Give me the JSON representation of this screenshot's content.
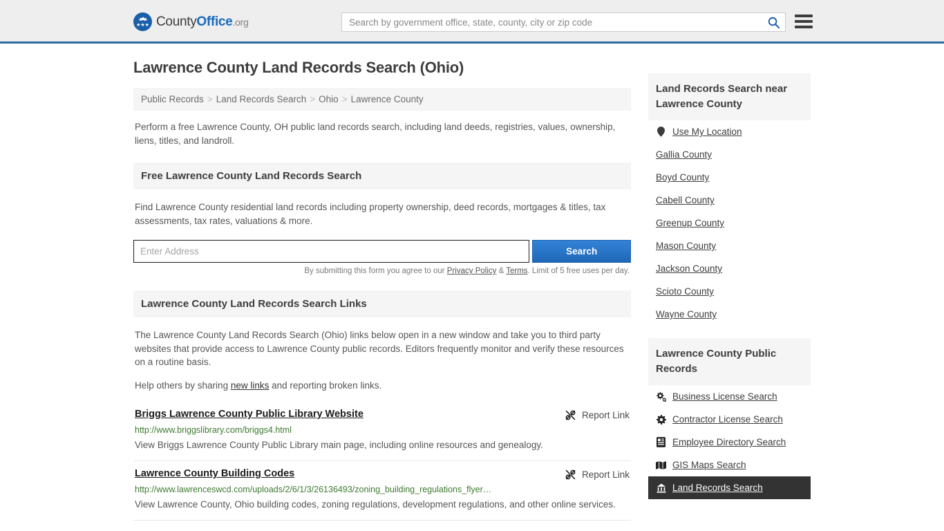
{
  "header": {
    "logo": {
      "part1": "County",
      "part2": "Office",
      "part3": ".org",
      "icon": "eagle-seal-icon"
    },
    "search_placeholder": "Search by government office, state, county, city or zip code",
    "search_value": "",
    "search_icon": "search-icon",
    "menu_icon": "hamburger-menu-icon"
  },
  "page": {
    "title": "Lawrence County Land Records Search (Ohio)",
    "intro": "Perform a free Lawrence County, OH public land records search, including land deeds, registries, values, ownership, liens, titles, and landroll."
  },
  "breadcrumb": {
    "items": [
      "Public Records",
      "Land Records Search",
      "Ohio",
      "Lawrence County"
    ],
    "separator": ">"
  },
  "free_search": {
    "heading": "Free Lawrence County Land Records Search",
    "description": "Find Lawrence County residential land records including property ownership, deed records, mortgages & titles, tax assessments, tax rates, valuations & more.",
    "input_placeholder": "Enter Address",
    "input_value": "",
    "submit_label": "Search",
    "note_prefix": "By submitting this form you agree to our ",
    "note_privacy": "Privacy Policy",
    "note_amp": " & ",
    "note_terms": "Terms",
    "note_suffix": ". Limit of 5 free uses per day."
  },
  "links_section": {
    "heading": "Lawrence County Land Records Search Links",
    "paragraph": "The Lawrence County Land Records Search (Ohio) links below open in a new window and take you to third party websites that provide access to Lawrence County public records. Editors frequently monitor and verify these resources on a routine basis.",
    "help_prefix": "Help others by sharing ",
    "help_link": "new links",
    "help_suffix": " and reporting broken links.",
    "report_label": "Report Link",
    "report_icon": "broken-link-icon",
    "results": [
      {
        "title": "Briggs Lawrence County Public Library Website",
        "url": "http://www.briggslibrary.com/briggs4.html",
        "description": "View Briggs Lawrence County Public Library main page, including online resources and genealogy."
      },
      {
        "title": "Lawrence County Building Codes",
        "url": "http://www.lawrenceswcd.com/uploads/2/6/1/3/26136493/zoning_building_regulations_flyer…",
        "description": "View Lawrence County, Ohio building codes, zoning regulations, development regulations, and other online services."
      }
    ]
  },
  "sidebar": {
    "nearby": {
      "heading": "Land Records Search near Lawrence County",
      "items": [
        {
          "label": "Use My Location",
          "icon": "map-pin-icon"
        },
        {
          "label": "Gallia County",
          "icon": ""
        },
        {
          "label": "Boyd County",
          "icon": ""
        },
        {
          "label": "Cabell County",
          "icon": ""
        },
        {
          "label": "Greenup County",
          "icon": ""
        },
        {
          "label": "Mason County",
          "icon": ""
        },
        {
          "label": "Jackson County",
          "icon": ""
        },
        {
          "label": "Scioto County",
          "icon": ""
        },
        {
          "label": "Wayne County",
          "icon": ""
        }
      ]
    },
    "public_records": {
      "heading": "Lawrence County Public Records",
      "items": [
        {
          "label": "Business License Search",
          "icon": "cogs-icon",
          "active": false
        },
        {
          "label": "Contractor License Search",
          "icon": "gear-icon",
          "active": false
        },
        {
          "label": "Employee Directory Search",
          "icon": "id-card-icon",
          "active": false
        },
        {
          "label": "GIS Maps Search",
          "icon": "map-icon",
          "active": false
        },
        {
          "label": "Land Records Search",
          "icon": "landmark-icon",
          "active": true
        }
      ]
    }
  },
  "colors": {
    "accent_blue": "#1a5fa8",
    "header_bg": "#eeeeee",
    "header_border": "#2d6ca2",
    "panel_bg": "#f5f5f5",
    "url_green": "#3f7a33",
    "active_bg": "#333333"
  }
}
